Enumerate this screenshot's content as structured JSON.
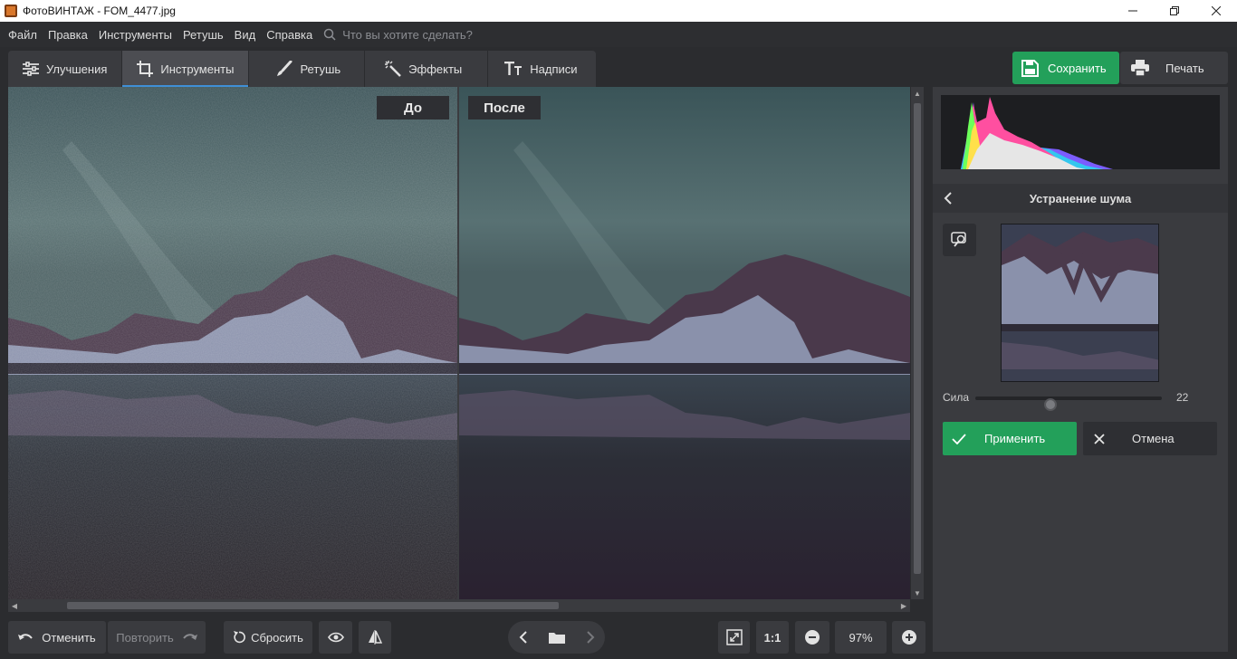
{
  "window": {
    "title": "ФотоВИНТАЖ - FOM_4477.jpg"
  },
  "menu": {
    "items": [
      "Файл",
      "Правка",
      "Инструменты",
      "Ретушь",
      "Вид",
      "Справка"
    ],
    "search_placeholder": "Что вы хотите сделать?"
  },
  "tabs": [
    {
      "label": "Улучшения",
      "icon": "sliders-icon"
    },
    {
      "label": "Инструменты",
      "icon": "crop-icon",
      "active": true
    },
    {
      "label": "Ретушь",
      "icon": "brush-icon"
    },
    {
      "label": "Эффекты",
      "icon": "magic-wand-icon"
    },
    {
      "label": "Надписи",
      "icon": "text-icon"
    }
  ],
  "actions": {
    "save_label": "Сохранить",
    "print_label": "Печать"
  },
  "canvas": {
    "before_label": "До",
    "after_label": "После"
  },
  "bottom": {
    "undo_label": "Отменить",
    "redo_label": "Повторить",
    "reset_label": "Сбросить",
    "ratio_label": "1:1",
    "zoom": "97%"
  },
  "panel": {
    "title": "Устранение шума",
    "slider_label": "Сила",
    "slider_value": "22",
    "slider_fraction": 0.22,
    "apply_label": "Применить",
    "cancel_label": "Отмена"
  },
  "colors": {
    "accent_green": "#23a05a",
    "active_tab_underline": "#3f8fd6",
    "background": "#2b2c2f",
    "panel": "#3a3b3f"
  }
}
